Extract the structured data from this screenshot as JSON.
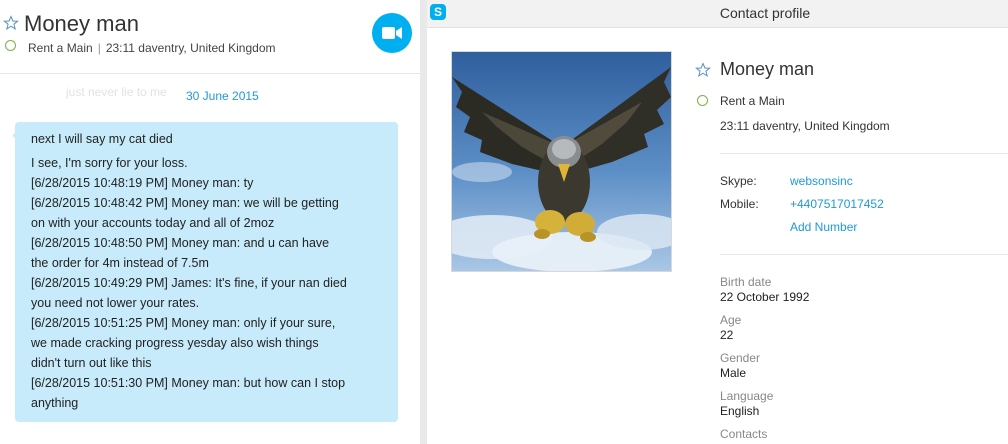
{
  "chat_header": {
    "name": "Money man",
    "mood": "Rent a Main",
    "local_time_location": "23:11 daventry, United Kingdom",
    "separator": "|"
  },
  "chat": {
    "faded_preview": "just never lie to me",
    "date_separator": "30 June 2015",
    "messages": [
      "next I will say my cat died",
      "I see, I'm sorry for your loss.",
      "[6/28/2015 10:48:19 PM] Money man: ty",
      "[6/28/2015 10:48:42 PM] Money man: we will be getting",
      "on with your accounts today and all of 2moz",
      "[6/28/2015 10:48:50 PM] Money man: and u can have",
      "the order for 4m instead of 7.5m",
      "[6/28/2015 10:49:29 PM] James: It's fine, if your nan died",
      "you need not lower your rates.",
      "[6/28/2015 10:51:25 PM] Money man: only if your sure,",
      "we made cracking progress yesday also wish things",
      "didn't turn out like this",
      "[6/28/2015 10:51:30 PM] Money man: but how can I stop",
      "anything"
    ]
  },
  "window": {
    "title": "Contact profile",
    "app_icon": "S"
  },
  "profile": {
    "name": "Money man",
    "mood": "Rent a Main",
    "local_time_location": "23:11 daventry, United Kingdom",
    "skype_label": "Skype:",
    "skype_value": "websonsinc",
    "mobile_label": "Mobile:",
    "mobile_value": "+4407517017452",
    "add_number": "Add Number",
    "details": [
      {
        "label": "Birth date",
        "value": "22 October 1992"
      },
      {
        "label": "Age",
        "value": "22"
      },
      {
        "label": "Gender",
        "value": "Male"
      },
      {
        "label": "Language",
        "value": "English"
      },
      {
        "label": "Contacts",
        "value": ""
      }
    ]
  },
  "colors": {
    "accent": "#00aff0",
    "link": "#1e9ad6",
    "bubble": "#c7ebfa",
    "status_online_ring": "#7cb342"
  },
  "icons": {
    "favorite": "star-outline-icon",
    "status": "status-circle-icon",
    "video": "video-camera-icon",
    "app": "skype-icon"
  }
}
